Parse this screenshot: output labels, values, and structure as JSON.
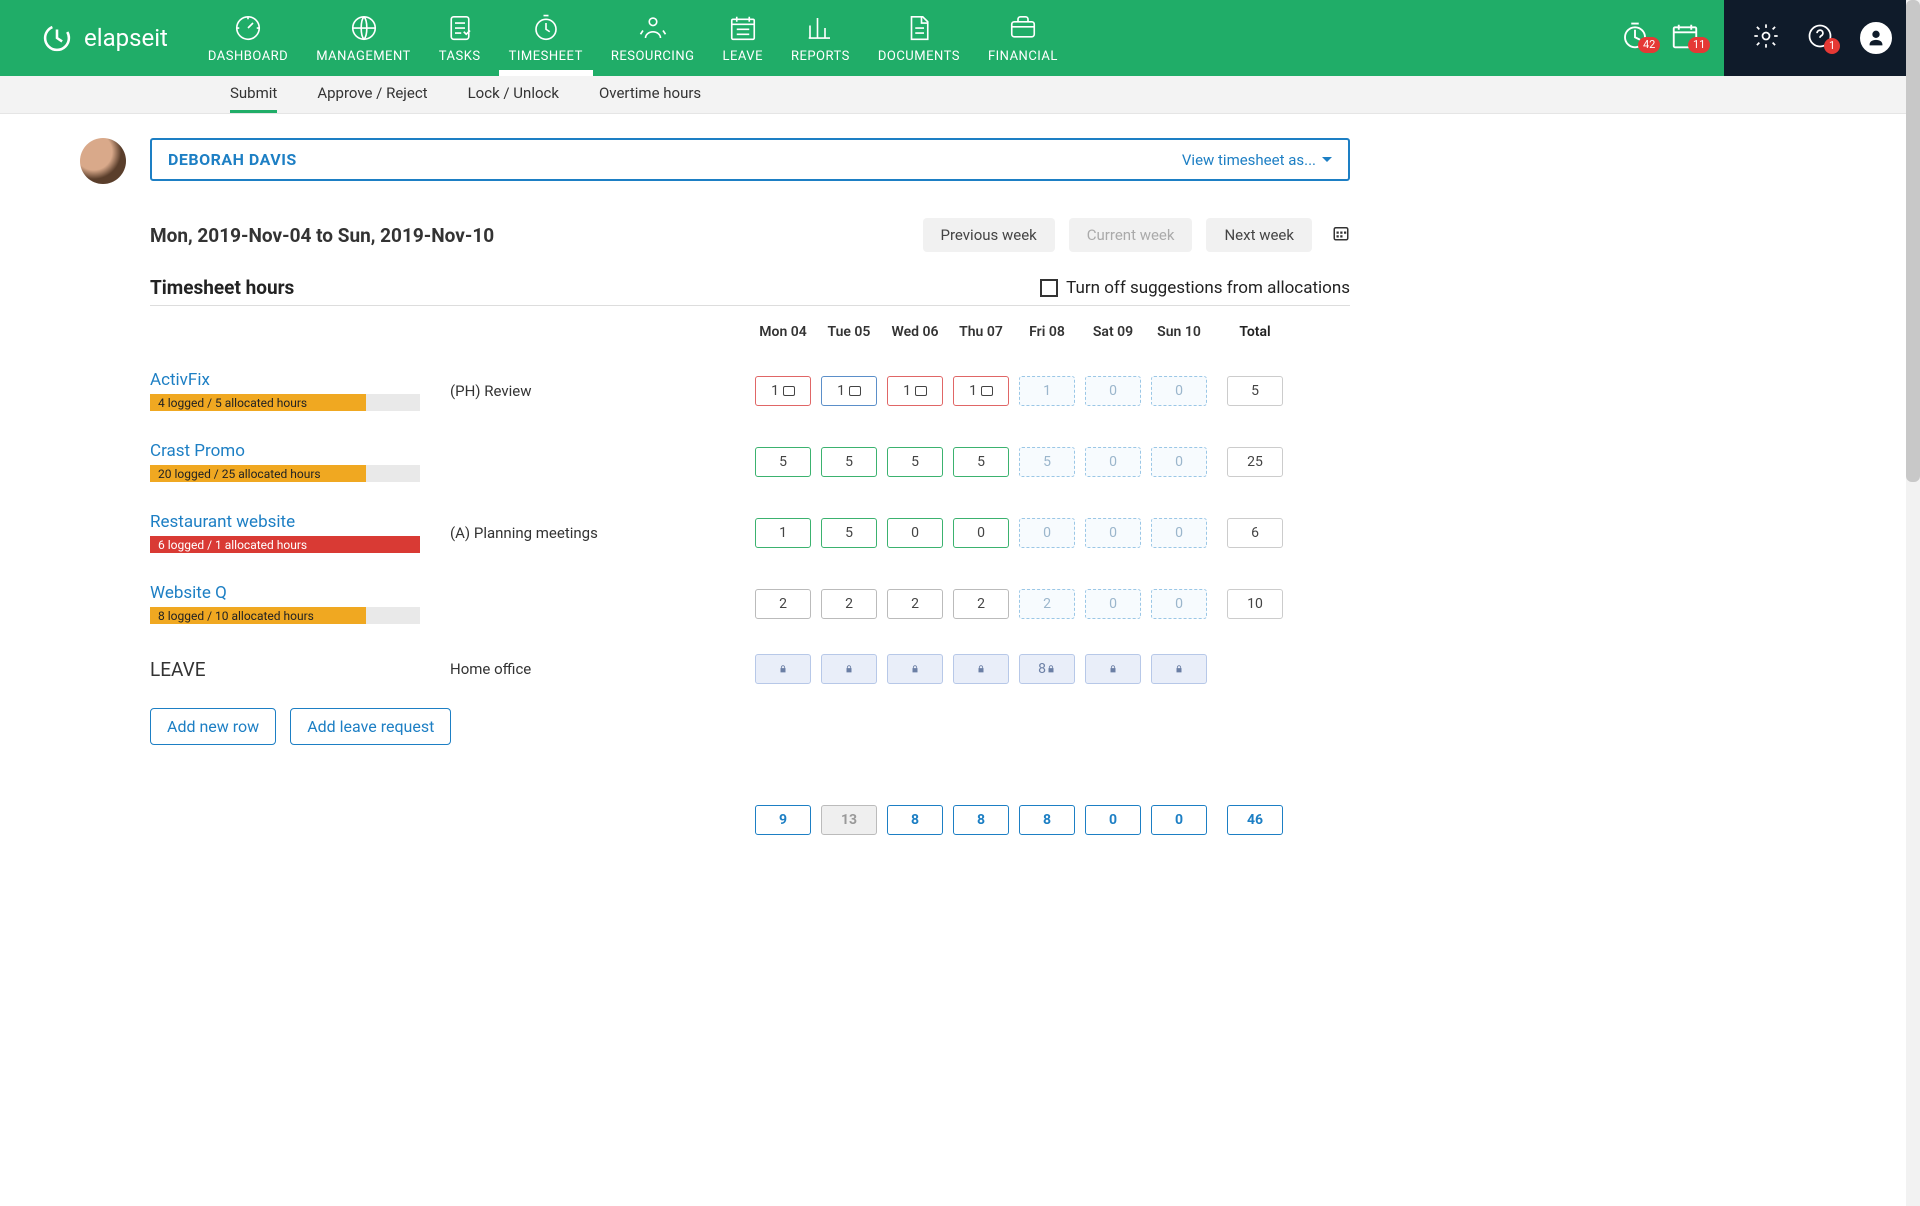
{
  "brand": "elapseit",
  "nav": [
    "DASHBOARD",
    "MANAGEMENT",
    "TASKS",
    "TIMESHEET",
    "RESOURCING",
    "LEAVE",
    "REPORTS",
    "DOCUMENTS",
    "FINANCIAL"
  ],
  "nav_active_index": 3,
  "top_badges": {
    "timer": "42",
    "calendar": "11",
    "help": "1"
  },
  "subnav": {
    "tabs": [
      "Submit",
      "Approve / Reject",
      "Lock / Unlock",
      "Overtime hours"
    ],
    "active_index": 0
  },
  "user": {
    "name": "DEBORAH DAVIS",
    "view_as_label": "View timesheet as..."
  },
  "range_label": "Mon, 2019-Nov-04 to Sun, 2019-Nov-10",
  "week_nav": {
    "prev": "Previous week",
    "current": "Current week",
    "next": "Next week"
  },
  "section_title": "Timesheet hours",
  "suggestions_label": "Turn off suggestions from allocations",
  "day_headers": [
    "Mon 04",
    "Tue 05",
    "Wed 06",
    "Thu 07",
    "Fri 08",
    "Sat 09",
    "Sun 10"
  ],
  "total_label": "Total",
  "rows": [
    {
      "project": "ActivFix",
      "bar_text": "4 logged / 5 allocated hours",
      "bar_pct": 80,
      "bar_color": "orange",
      "phase": "(PH) Review",
      "cells": [
        {
          "v": "1",
          "style": "red",
          "note": true
        },
        {
          "v": "1",
          "style": "blue",
          "note": true
        },
        {
          "v": "1",
          "style": "red",
          "note": true
        },
        {
          "v": "1",
          "style": "red",
          "note": true
        },
        {
          "v": "1",
          "style": "dash"
        },
        {
          "v": "0",
          "style": "dash"
        },
        {
          "v": "0",
          "style": "dash"
        }
      ],
      "total": "5"
    },
    {
      "project": "Crast Promo",
      "bar_text": "20 logged / 25 allocated hours",
      "bar_pct": 80,
      "bar_color": "orange",
      "phase": "",
      "cells": [
        {
          "v": "5",
          "style": "green"
        },
        {
          "v": "5",
          "style": "green"
        },
        {
          "v": "5",
          "style": "green"
        },
        {
          "v": "5",
          "style": "green"
        },
        {
          "v": "5",
          "style": "dash"
        },
        {
          "v": "0",
          "style": "dash"
        },
        {
          "v": "0",
          "style": "dash"
        }
      ],
      "total": "25"
    },
    {
      "project": "Restaurant website",
      "bar_text": "6 logged / 1 allocated hours",
      "bar_pct": 100,
      "bar_color": "red",
      "phase": "(A) Planning meetings",
      "cells": [
        {
          "v": "1",
          "style": "green"
        },
        {
          "v": "5",
          "style": "green"
        },
        {
          "v": "0",
          "style": "green"
        },
        {
          "v": "0",
          "style": "green"
        },
        {
          "v": "0",
          "style": "dash"
        },
        {
          "v": "0",
          "style": "dash"
        },
        {
          "v": "0",
          "style": "dash"
        }
      ],
      "total": "6"
    },
    {
      "project": "Website Q",
      "bar_text": "8 logged / 10 allocated hours",
      "bar_pct": 80,
      "bar_color": "orange",
      "phase": "",
      "cells": [
        {
          "v": "2",
          "style": "gray"
        },
        {
          "v": "2",
          "style": "gray"
        },
        {
          "v": "2",
          "style": "gray"
        },
        {
          "v": "2",
          "style": "gray"
        },
        {
          "v": "2",
          "style": "dash"
        },
        {
          "v": "0",
          "style": "dash"
        },
        {
          "v": "0",
          "style": "dash"
        }
      ],
      "total": "10"
    }
  ],
  "leave_row": {
    "label": "LEAVE",
    "phase": "Home office",
    "cells": [
      {
        "v": "",
        "style": "lock",
        "lock": true
      },
      {
        "v": "",
        "style": "lock",
        "lock": true
      },
      {
        "v": "",
        "style": "lock",
        "lock": true
      },
      {
        "v": "",
        "style": "lock",
        "lock": true
      },
      {
        "v": "8",
        "style": "lock",
        "lock": true
      },
      {
        "v": "",
        "style": "lock",
        "lock": true
      },
      {
        "v": "",
        "style": "lock",
        "lock": true
      }
    ]
  },
  "actions": {
    "add_row": "Add new row",
    "add_leave": "Add leave request"
  },
  "sums": {
    "days": [
      "9",
      "13",
      "8",
      "8",
      "8",
      "0",
      "0"
    ],
    "dim_index": 1,
    "total": "46"
  }
}
